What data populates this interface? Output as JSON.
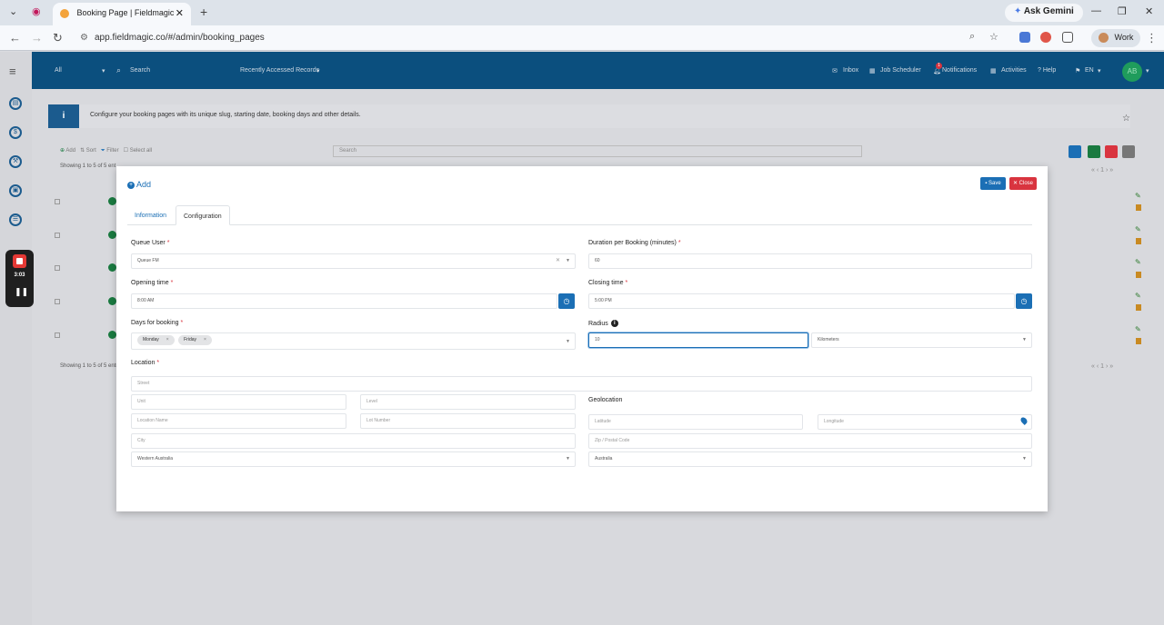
{
  "browser": {
    "tab_title": "Booking Page | Fieldmagic",
    "url": "app.fieldmagic.co/#/admin/booking_pages",
    "gemini_label": "Ask Gemini",
    "profile_label": "Work"
  },
  "header": {
    "scope": "All",
    "search_placeholder": "Search",
    "recent": "Recently Accessed Records",
    "inbox": "Inbox",
    "job_scheduler": "Job Scheduler",
    "notifications": "Notifications",
    "notification_count": "1",
    "activities": "Activities",
    "help": "? Help",
    "language": "EN",
    "avatar": "AB"
  },
  "page": {
    "info_text": "Configure your booking pages with its unique slug, starting date, booking days and other details.",
    "list_add": "Add",
    "list_sort": "Sort",
    "list_filter": "Filter",
    "list_select_all": "Select all",
    "list_search_placeholder": "Search",
    "showing_top": "Showing 1 to 5 of 5 ent",
    "showing_bottom": "Showing 1 to 5 of 5 entri",
    "pager_page": "1"
  },
  "recorder": {
    "time": "3:03"
  },
  "modal": {
    "add_label": "Add",
    "save_label": "Save",
    "close_label": "Close",
    "tabs": [
      "Information",
      "Configuration"
    ],
    "queue_user_label": "Queue User",
    "queue_user_value": "Queue FM",
    "duration_label": "Duration per Booking (minutes)",
    "duration_value": "60",
    "opening_label": "Opening time",
    "opening_value": "8:00 AM",
    "closing_label": "Closing time",
    "closing_value": "5:00 PM",
    "days_label": "Days for booking",
    "days": [
      "Monday",
      "Friday"
    ],
    "radius_label": "Radius",
    "radius_value": "10",
    "radius_unit": "Kilometers",
    "location_label": "Location",
    "street_ph": "Street",
    "unit_ph": "Unit",
    "level_ph": "Level",
    "location_name_ph": "Location Name",
    "lot_number_ph": "Lot Number",
    "city_ph": "City",
    "state_value": "Western Australia",
    "geolocation_label": "Geolocation",
    "latitude_ph": "Latitude",
    "longitude_ph": "Longitude",
    "zip_ph": "Zip / Postal Code",
    "country_value": "Australia"
  },
  "colors": {
    "header_bg": "#0b4f7e",
    "primary": "#1b6fb5",
    "danger": "#d9343f",
    "success": "#1a7a40"
  }
}
